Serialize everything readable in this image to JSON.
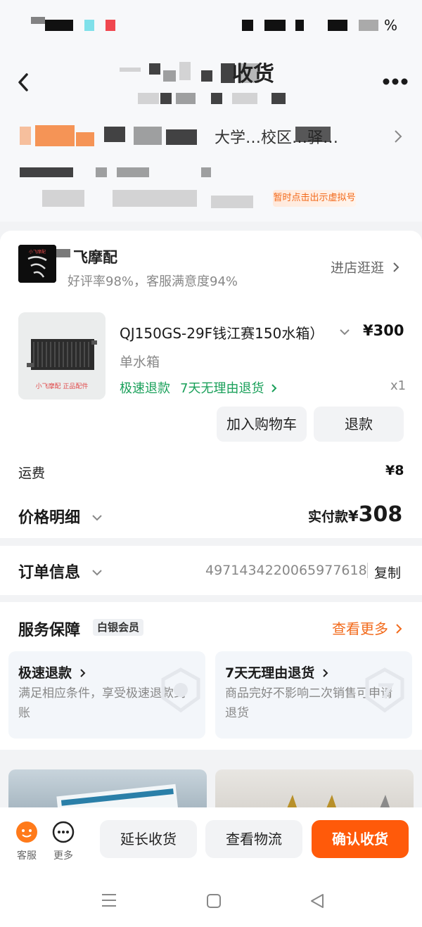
{
  "status_bar": {
    "battery_suffix": "%"
  },
  "header": {
    "title_suffix": "收货",
    "address_line_fragment": "大学…校区…驿…",
    "virtual_badge": "暂时点击出示虚拟号"
  },
  "shop": {
    "name": "飞摩配",
    "rating": "好评率98%，客服满意度94%",
    "enter_label": "进店逛逛",
    "logo_text": "小飞摩配"
  },
  "product": {
    "title": "QJ150GS-29F钱江赛150水箱）",
    "price": "¥300",
    "spec": "单水箱",
    "tag_fast_refund": "极速退款",
    "tag_seven_day": "7天无理由退货",
    "quantity": "x1",
    "image_caption": "小飞摩配 正品配件",
    "add_cart_label": "加入购物车",
    "refund_label": "退款"
  },
  "shipping": {
    "label": "运费",
    "value": "¥8"
  },
  "price_detail": {
    "label": "价格明细",
    "paid_label": "实付款",
    "paid_currency": "¥",
    "paid_value": "308"
  },
  "order_info": {
    "label": "订单信息",
    "order_number": "4971434220065977618",
    "copy_label": "复制"
  },
  "service": {
    "title": "服务保障",
    "member_badge": "白银会员",
    "see_more": "查看更多",
    "items": [
      {
        "title": "极速退款",
        "desc": "满足相应条件，享受极速退款到账"
      },
      {
        "title": "7天无理由退货",
        "desc": "商品完好不影响二次销售可申请退货"
      }
    ]
  },
  "bottom_bar": {
    "service_label": "客服",
    "more_label": "更多",
    "extend_label": "延长收货",
    "logistics_label": "查看物流",
    "confirm_label": "确认收货"
  },
  "colors": {
    "accent_orange": "#ff5a0a",
    "green": "#1aa05a",
    "link_orange": "#f26a1b"
  }
}
